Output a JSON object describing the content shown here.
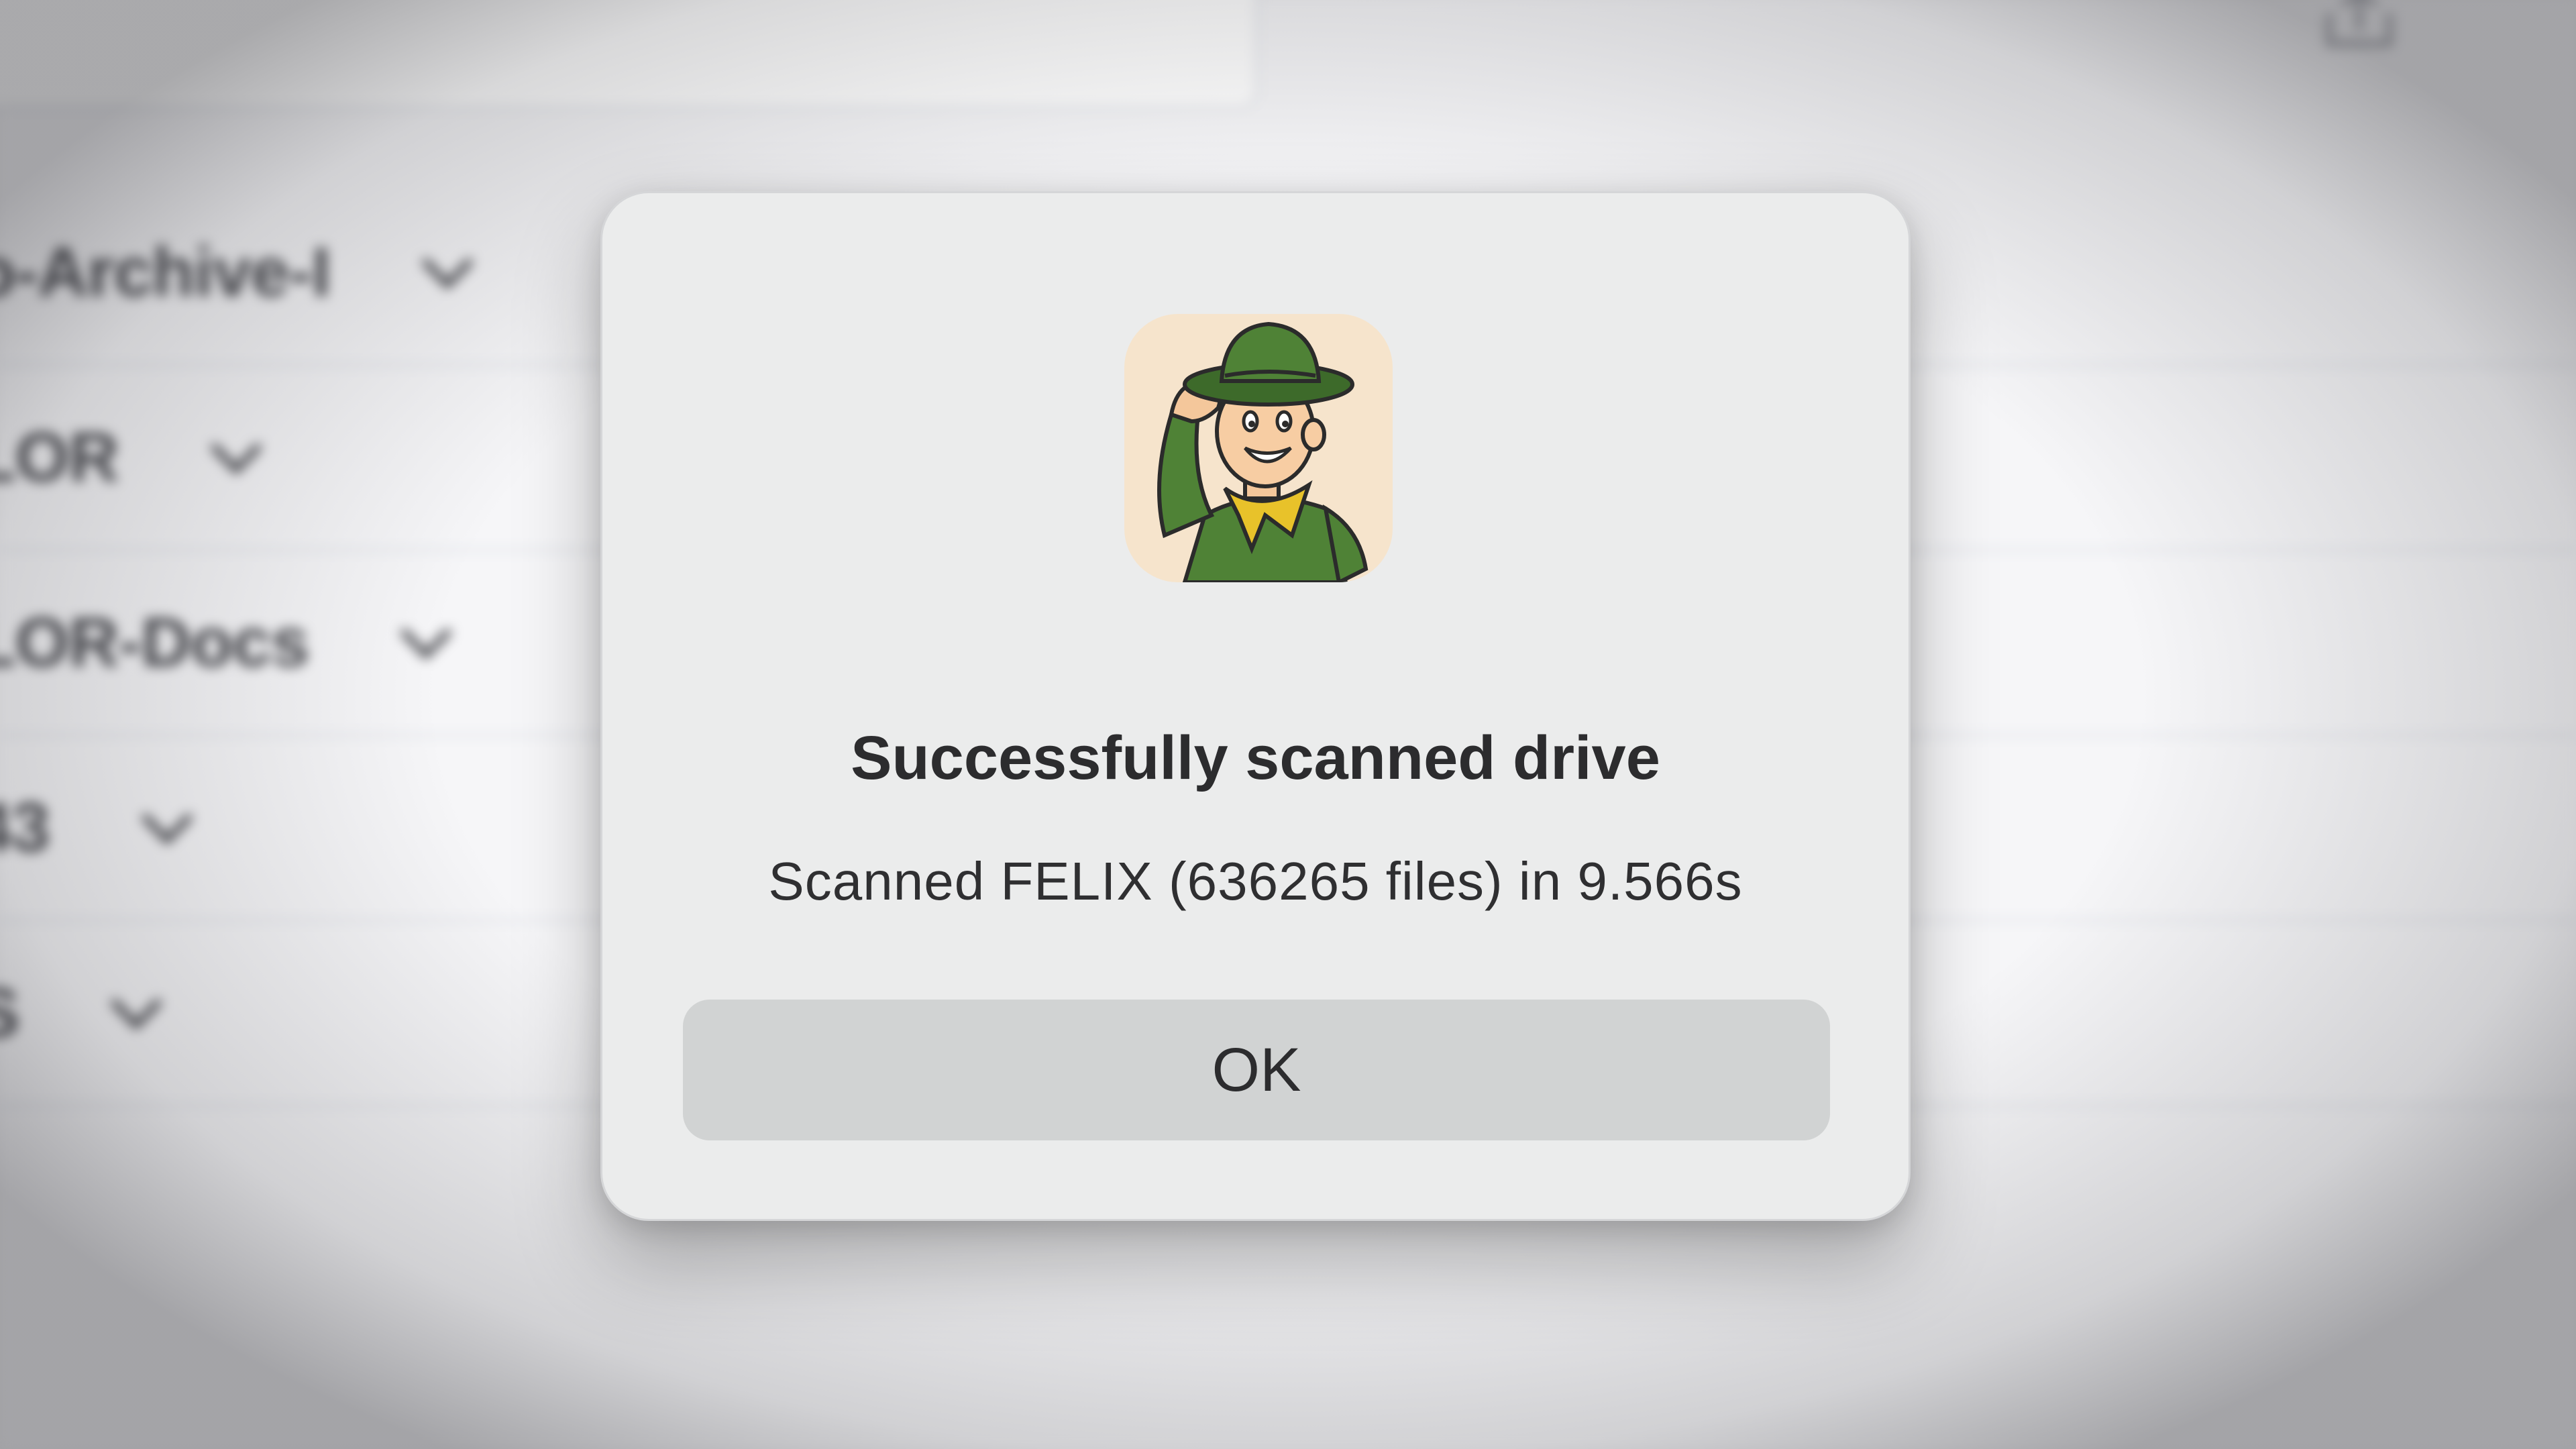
{
  "background": {
    "drives": [
      {
        "name": "o-Archive-I"
      },
      {
        "name": "LOR"
      },
      {
        "name": "LOR-Docs"
      },
      {
        "name": "43"
      },
      {
        "name": "S"
      }
    ]
  },
  "dialog": {
    "icon": "scout-mascot-app-icon",
    "title": "Successfully scanned drive",
    "message": "Scanned FELIX (636265 files) in 9.566s",
    "ok_label": "OK"
  },
  "colors": {
    "dialog_bg": "#ebecec",
    "button_bg": "#d1d3d3",
    "text": "#2c2c2e",
    "scout_green": "#4a7a32",
    "scarf_yellow": "#e8c22a"
  }
}
